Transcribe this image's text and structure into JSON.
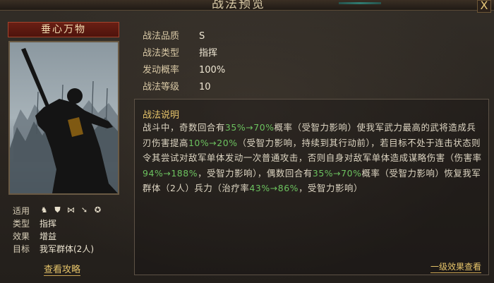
{
  "window": {
    "title": "战法预览",
    "close_label": "X"
  },
  "card": {
    "name": "垂心万物",
    "info": [
      {
        "label": "适用",
        "value": ""
      },
      {
        "label": "类型",
        "value": "指挥"
      },
      {
        "label": "效果",
        "value": "增益"
      },
      {
        "label": "目标",
        "value": "我军群体(2人)"
      }
    ],
    "unit_icons": [
      "cavalry-icon",
      "shield-icon",
      "bow-icon",
      "spear-icon",
      "siege-icon"
    ],
    "guide_link": "查看攻略"
  },
  "stats": [
    {
      "label": "战法品质",
      "value": "S"
    },
    {
      "label": "战法类型",
      "value": "指挥"
    },
    {
      "label": "发动概率",
      "value": "100%"
    },
    {
      "label": "战法等级",
      "value": "10"
    }
  ],
  "description": {
    "title": "战法说明",
    "segments": [
      {
        "t": "战斗中，奇数回合有"
      },
      {
        "t": "35%→70%",
        "hl": true
      },
      {
        "t": "概率（受智力影响）使我军武力最高的武将造成兵刃伤害提高"
      },
      {
        "t": "10%→20%",
        "hl": true
      },
      {
        "t": "（受智力影响，持续到其行动前），若目标不处于连击状态则令其尝试对敌军单体发动一次普通攻击，否则自身对敌军单体造成谋略伤害（伤害率"
      },
      {
        "t": "94%→188%",
        "hl": true
      },
      {
        "t": "，受智力影响），偶数回合有"
      },
      {
        "t": "35%→70%",
        "hl": true
      },
      {
        "t": "概率（受智力影响）恢复我军群体（2人）兵力（治疗率"
      },
      {
        "t": "43%→86%",
        "hl": true
      },
      {
        "t": "，受智力影响）"
      }
    ]
  },
  "level_effect_link": "一级效果查看",
  "colors": {
    "highlight": "#6cc25f",
    "gold": "#e6c46a",
    "banner": "#6a1f14"
  }
}
